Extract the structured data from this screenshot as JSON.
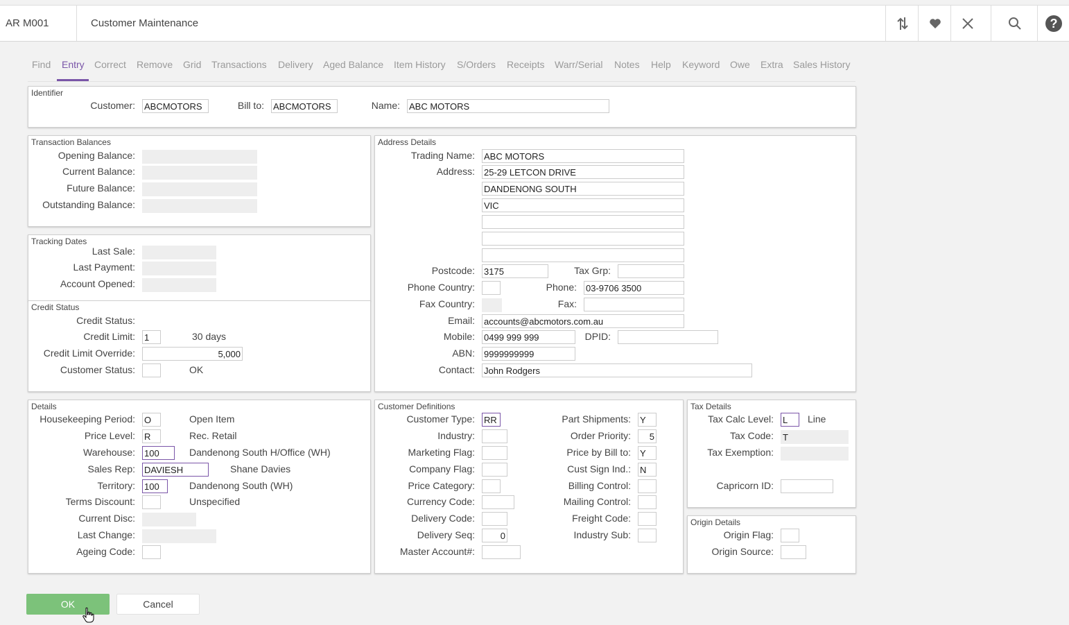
{
  "header": {
    "program_code": "AR M001",
    "title": "Customer Maintenance"
  },
  "toolbar_icons": [
    "swap-icon",
    "heart-icon",
    "close-icon",
    "search-icon",
    "help-icon"
  ],
  "tabs": [
    "Find",
    "Entry",
    "Correct",
    "Remove",
    "Grid",
    "Transactions",
    "Delivery",
    "Aged Balance",
    "Item History",
    "S/Orders",
    "Receipts",
    "Warr/Serial",
    "Notes",
    "Help",
    "Keyword",
    "Owe",
    "Extra",
    "Sales History"
  ],
  "identifier": {
    "title": "Identifier",
    "customer_label": "Customer:",
    "customer": "ABCMOTORS",
    "billto_label": "Bill to:",
    "billto": "ABCMOTORS",
    "name_label": "Name:",
    "name": "ABC MOTORS"
  },
  "balances": {
    "title": "Transaction Balances",
    "opening": "Opening Balance:",
    "current": "Current Balance:",
    "future": "Future Balance:",
    "outstanding": "Outstanding Balance:"
  },
  "tracking": {
    "title": "Tracking Dates",
    "last_sale": "Last Sale:",
    "last_payment": "Last Payment:",
    "account_opened": "Account Opened:"
  },
  "credit": {
    "title": "Credit Status",
    "status_label": "Credit Status:",
    "limit_label": "Credit Limit:",
    "limit": "1",
    "limit_desc": "30 days",
    "override_label": "Credit Limit Override:",
    "override": "5,000",
    "cust_status_label": "Customer Status:",
    "cust_status": "",
    "cust_status_desc": "OK"
  },
  "address": {
    "title": "Address Details",
    "trading_label": "Trading Name:",
    "trading": "ABC MOTORS",
    "address_label": "Address:",
    "line1": "25-29 LETCON DRIVE",
    "line2": "DANDENONG SOUTH",
    "line3": "VIC",
    "line4": "",
    "line5": "",
    "line6": "",
    "postcode_label": "Postcode:",
    "postcode": "3175",
    "taxgrp_label": "Tax Grp:",
    "taxgrp": "",
    "phone_country_label": "Phone Country:",
    "phone_country": "",
    "phone_label": "Phone:",
    "phone": "03-9706 3500",
    "fax_country_label": "Fax Country:",
    "fax_label": "Fax:",
    "fax": "",
    "email_label": "Email:",
    "email": "accounts@abcmotors.com.au",
    "mobile_label": "Mobile:",
    "mobile": "0499 999 999",
    "dpid_label": "DPID:",
    "dpid": "",
    "abn_label": "ABN:",
    "abn": "9999999999",
    "contact_label": "Contact:",
    "contact": "John Rodgers"
  },
  "details": {
    "title": "Details",
    "hk_label": "Housekeeping Period:",
    "hk": "O",
    "hk_desc": "Open Item",
    "price_label": "Price Level:",
    "price": "R",
    "price_desc": "Rec. Retail",
    "wh_label": "Warehouse:",
    "wh": "100",
    "wh_desc": "Dandenong South H/Office (WH)",
    "rep_label": "Sales Rep:",
    "rep": "DAVIESH",
    "rep_desc": "Shane Davies",
    "terr_label": "Territory:",
    "terr": "100",
    "terr_desc": "Dandenong South (WH)",
    "terms_label": "Terms Discount:",
    "terms": "",
    "terms_desc": "Unspecified",
    "curdisc_label": "Current Disc:",
    "lastchange_label": "Last Change:",
    "ageing_label": "Ageing Code:",
    "ageing": ""
  },
  "custdef": {
    "title": "Customer Definitions",
    "type_label": "Customer Type:",
    "type": "RR",
    "industry_label": "Industry:",
    "industry": "",
    "marketing_label": "Marketing Flag:",
    "marketing": "",
    "company_label": "Company Flag:",
    "company": "",
    "pricecat_label": "Price Category:",
    "pricecat": "",
    "currency_label": "Currency Code:",
    "currency": "",
    "delcode_label": "Delivery Code:",
    "delcode": "",
    "delseq_label": "Delivery Seq:",
    "delseq": "0",
    "master_label": "Master Account#:",
    "master": "",
    "partship_label": "Part Shipments:",
    "partship": "Y",
    "orderprio_label": "Order Priority:",
    "orderprio": "5",
    "pricebill_label": "Price by Bill to:",
    "pricebill": "Y",
    "custsign_label": "Cust Sign Ind.:",
    "custsign": "N",
    "billing_label": "Billing Control:",
    "billing": "",
    "mailing_label": "Mailing Control:",
    "mailing": "",
    "freight_label": "Freight Code:",
    "freight": "",
    "indsub_label": "Industry Sub:",
    "indsub": ""
  },
  "tax": {
    "title": "Tax Details",
    "calc_label": "Tax Calc Level:",
    "calc": "L",
    "calc_desc": "Line",
    "code_label": "Tax Code:",
    "code": "T",
    "exempt_label": "Tax Exemption:",
    "capricorn_label": "Capricorn ID:",
    "capricorn": ""
  },
  "origin": {
    "title": "Origin Details",
    "flag_label": "Origin Flag:",
    "flag": "",
    "source_label": "Origin Source:",
    "source": ""
  },
  "buttons": {
    "ok": "OK",
    "cancel": "Cancel"
  }
}
